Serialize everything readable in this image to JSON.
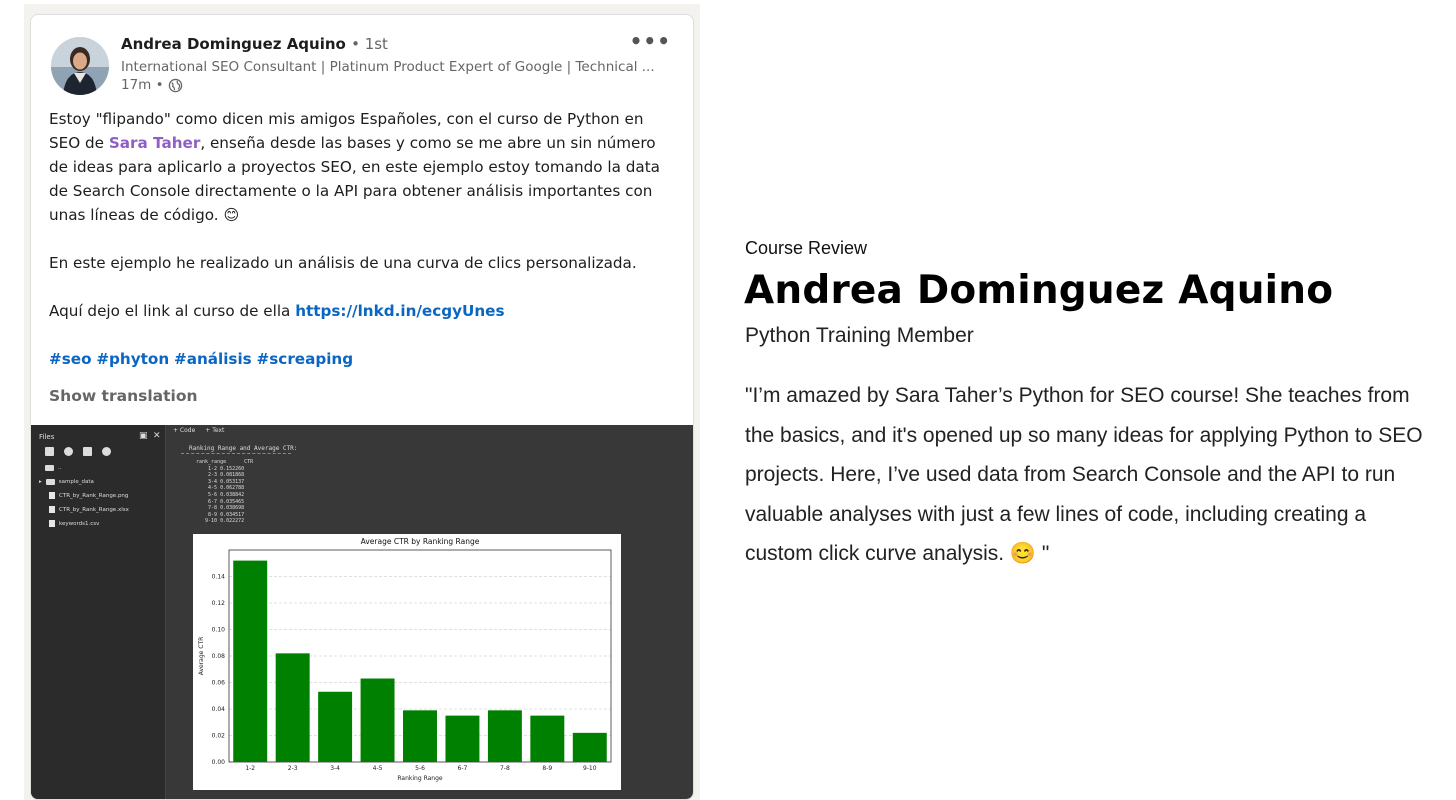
{
  "post": {
    "author": {
      "name": "Andrea Dominguez Aquino",
      "degree": "• 1st",
      "headline": "International SEO Consultant | Platinum Product Expert of Google | Technical ...",
      "time": "17m •"
    },
    "more_label": "•••",
    "body": {
      "p1_a": "Estoy \"flipando\" como dicen mis amigos Españoles, con el curso de Python en SEO de ",
      "mention": "Sara Taher",
      "p1_b": ", enseña desde las bases y como se me abre un sin número de ideas para aplicarlo a proyectos SEO, en este ejemplo estoy tomando la data de Search Console directamente o la API para obtener análisis importantes con unas líneas de código. 😊",
      "p2": "En este ejemplo he realizado un análisis de una curva de clics personalizada.",
      "p3_a": "Aquí dejo el link al curso de ella ",
      "link": "https://lnkd.in/ecgyUnes",
      "hashtags": [
        "#seo",
        "#phyton",
        "#análisis",
        "#screaping"
      ]
    },
    "show_translation": "Show translation"
  },
  "colab": {
    "files_title": "Files",
    "toolbar": [
      "+ Code",
      "+ Text"
    ],
    "cell_title": "Ranking Range and Average CTR:",
    "files": [
      {
        "name": "..",
        "kind": "folder"
      },
      {
        "name": "sample_data",
        "kind": "folder"
      },
      {
        "name": "CTR_by_Rank_Range.png",
        "kind": "file"
      },
      {
        "name": "CTR_by_Rank_Range.xlsx",
        "kind": "file"
      },
      {
        "name": "keywords1.csv",
        "kind": "file"
      }
    ],
    "output_header": "rank_range      CTR",
    "output_rows": [
      "    1-2 0.152260",
      "    2-3 0.081868",
      "    3-4 0.053137",
      "    4-5 0.062788",
      "    5-6 0.038842",
      "    6-7 0.035465",
      "    7-8 0.038698",
      "    8-9 0.034517",
      "   9-10 0.022272"
    ]
  },
  "chart_data": {
    "type": "bar",
    "title": "Average CTR by Ranking Range",
    "xlabel": "Ranking Range",
    "ylabel": "Average CTR",
    "categories": [
      "1-2",
      "2-3",
      "3-4",
      "4-5",
      "5-6",
      "6-7",
      "7-8",
      "8-9",
      "9-10"
    ],
    "values": [
      0.152,
      0.082,
      0.053,
      0.063,
      0.039,
      0.035,
      0.039,
      0.035,
      0.022
    ],
    "ylim": [
      0,
      0.16
    ],
    "yticks": [
      0.0,
      0.02,
      0.04,
      0.06,
      0.08,
      0.1,
      0.12,
      0.14
    ],
    "ytick_labels": [
      "0.00",
      "0.02",
      "0.04",
      "0.06",
      "0.08",
      "0.10",
      "0.12",
      "0.14"
    ],
    "grid": true,
    "bar_color": "#008000"
  },
  "review": {
    "label": "Course Review",
    "name": "Andrea Dominguez Aquino",
    "role": "Python Training Member",
    "quote": "\"I’m amazed by Sara Taher’s Python for SEO course! She teaches from the basics, and it's opened up so many ideas for applying Python to SEO projects. Here, I’ve used data from Search Console and the API to run valuable analyses with just a few lines of code, including creating a custom click curve analysis. 😊 \""
  },
  "colors": {
    "link": "#0a66c2",
    "mention": "#8f5fc6",
    "colab_bg": "#383838"
  }
}
